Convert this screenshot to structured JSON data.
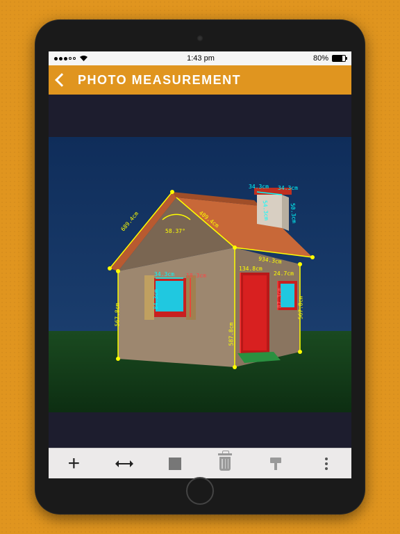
{
  "statusBar": {
    "time": "1:43 pm",
    "battery": "80%"
  },
  "header": {
    "title": "PHOTO MEASUREMENT"
  },
  "measurements": {
    "roofLeft": "689.4cm",
    "roofRightA": "489.4cm",
    "roofRightB": "934.3cm",
    "angle": "58.37°",
    "chimneyA": "34.3cm",
    "chimneyB": "34.3cm",
    "chimneyC": "54.3cm",
    "chimneyD": "50.3cm",
    "wallLeft": "567.8cm",
    "wallRight": "567.8cm",
    "wallFrontLeft": "587.8cm",
    "window1w": "34.3cm",
    "window1h": "84.3cm",
    "window1d": "18.3cm",
    "doorH": "134.8cm",
    "doorW": "24.7cm",
    "window2h": "87.3cm"
  },
  "toolbar": {
    "add": "add",
    "arrows": "resize",
    "area": "area",
    "delete": "delete",
    "paint": "paint",
    "more": "more"
  }
}
